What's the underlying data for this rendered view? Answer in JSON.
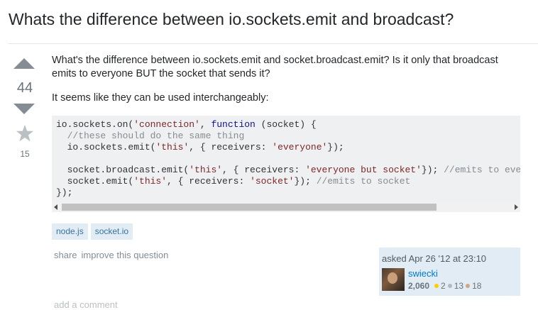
{
  "question": {
    "title": "Whats the difference between io.sockets.emit and broadcast?",
    "vote_count": "44",
    "favorite_count": "15",
    "body_p1": "What's the difference between io.sockets.emit and socket.broadcast.emit? Is it only that broadcast emits to everyone BUT the socket that sends it?",
    "body_p2": "It seems like they can be used interchangeably:",
    "code": {
      "l1_a": "io.sockets.on(",
      "l1_str": "'connection'",
      "l1_b": ", ",
      "l1_kw": "function",
      "l1_c": " (socket) {",
      "l2_cm": "  //these should do the same thing",
      "l3_a": "  io.sockets.emit(",
      "l3_str1": "'this'",
      "l3_b": ", { receivers: ",
      "l3_str2": "'everyone'",
      "l3_c": "});",
      "l5_a": "  socket.broadcast.emit(",
      "l5_str1": "'this'",
      "l5_b": ", { receivers: ",
      "l5_str2": "'everyone but socket'",
      "l5_c": "}); ",
      "l5_cm": "//emits to eve",
      "l6_a": "  socket.emit(",
      "l6_str1": "'this'",
      "l6_b": ", { receivers: ",
      "l6_str2": "'socket'",
      "l6_c": "}); ",
      "l6_cm": "//emits to socket",
      "l7": "});"
    },
    "tags": [
      "node.js",
      "socket.io"
    ],
    "menu": {
      "share": "share",
      "improve": "improve this question"
    },
    "owner": {
      "asked": "asked Apr 26 '12 at 23:10",
      "name": "swiecki",
      "reputation": "2,060",
      "gold": "2",
      "silver": "13",
      "bronze": "18"
    },
    "add_comment": "add a comment"
  },
  "colors": {
    "gold": "#ffcc01",
    "silver": "#b4b8bc",
    "bronze": "#d1a684",
    "link": "#0077cc",
    "tag_bg": "#e1ecf4"
  },
  "icons": {
    "upvote": "triangle-up-icon",
    "downvote": "triangle-down-icon",
    "favorite": "star-icon",
    "scroll_left": "arrow-left-icon",
    "scroll_right": "arrow-right-icon"
  }
}
